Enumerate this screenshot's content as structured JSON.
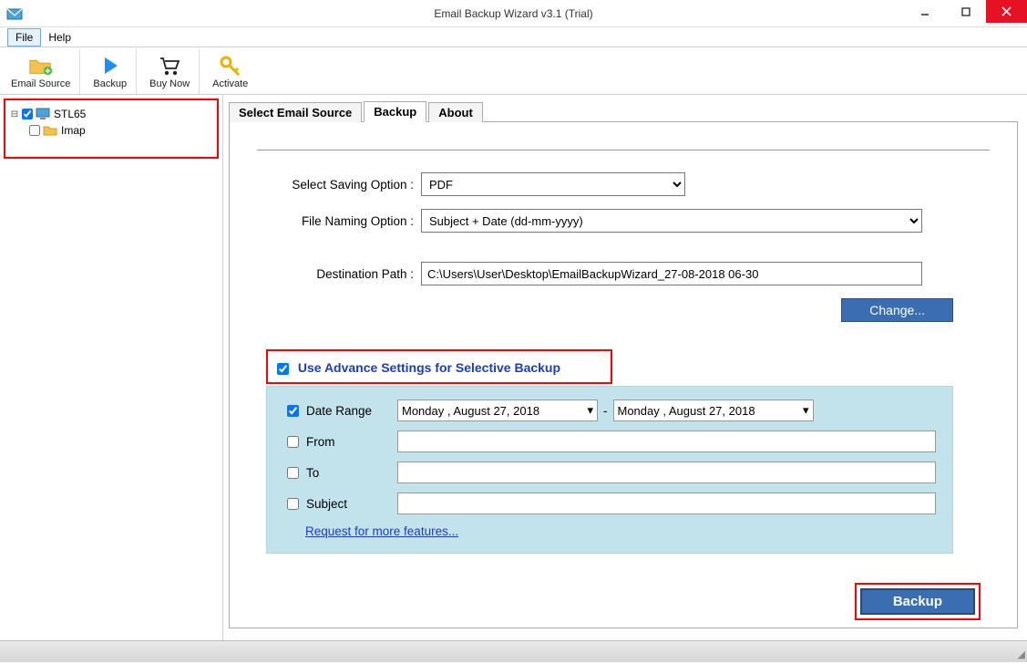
{
  "window": {
    "title": "Email Backup Wizard v3.1 (Trial)"
  },
  "menu": {
    "file": "File",
    "help": "Help"
  },
  "toolbar": {
    "email_source": "Email Source",
    "backup": "Backup",
    "buy_now": "Buy Now",
    "activate": "Activate"
  },
  "tree": {
    "root": "STL65",
    "child": "Imap"
  },
  "tabs": {
    "select_source": "Select Email Source",
    "backup": "Backup",
    "about": "About"
  },
  "form": {
    "saving_label": "Select Saving Option :",
    "saving_value": "PDF",
    "naming_label": "File Naming Option :",
    "naming_value": "Subject + Date (dd-mm-yyyy)",
    "dest_label": "Destination Path :",
    "dest_value": "C:\\Users\\User\\Desktop\\EmailBackupWizard_27-08-2018 06-30",
    "change_btn": "Change..."
  },
  "advance": {
    "checkbox_label": "Use Advance Settings for Selective Backup",
    "date_range": "Date Range",
    "date_from": "Monday   ,    August   27, 2018",
    "date_to": "Monday   ,    August   27, 2018",
    "from": "From",
    "to": "To",
    "subject": "Subject",
    "request": "Request for more features..."
  },
  "backup_button": "Backup"
}
